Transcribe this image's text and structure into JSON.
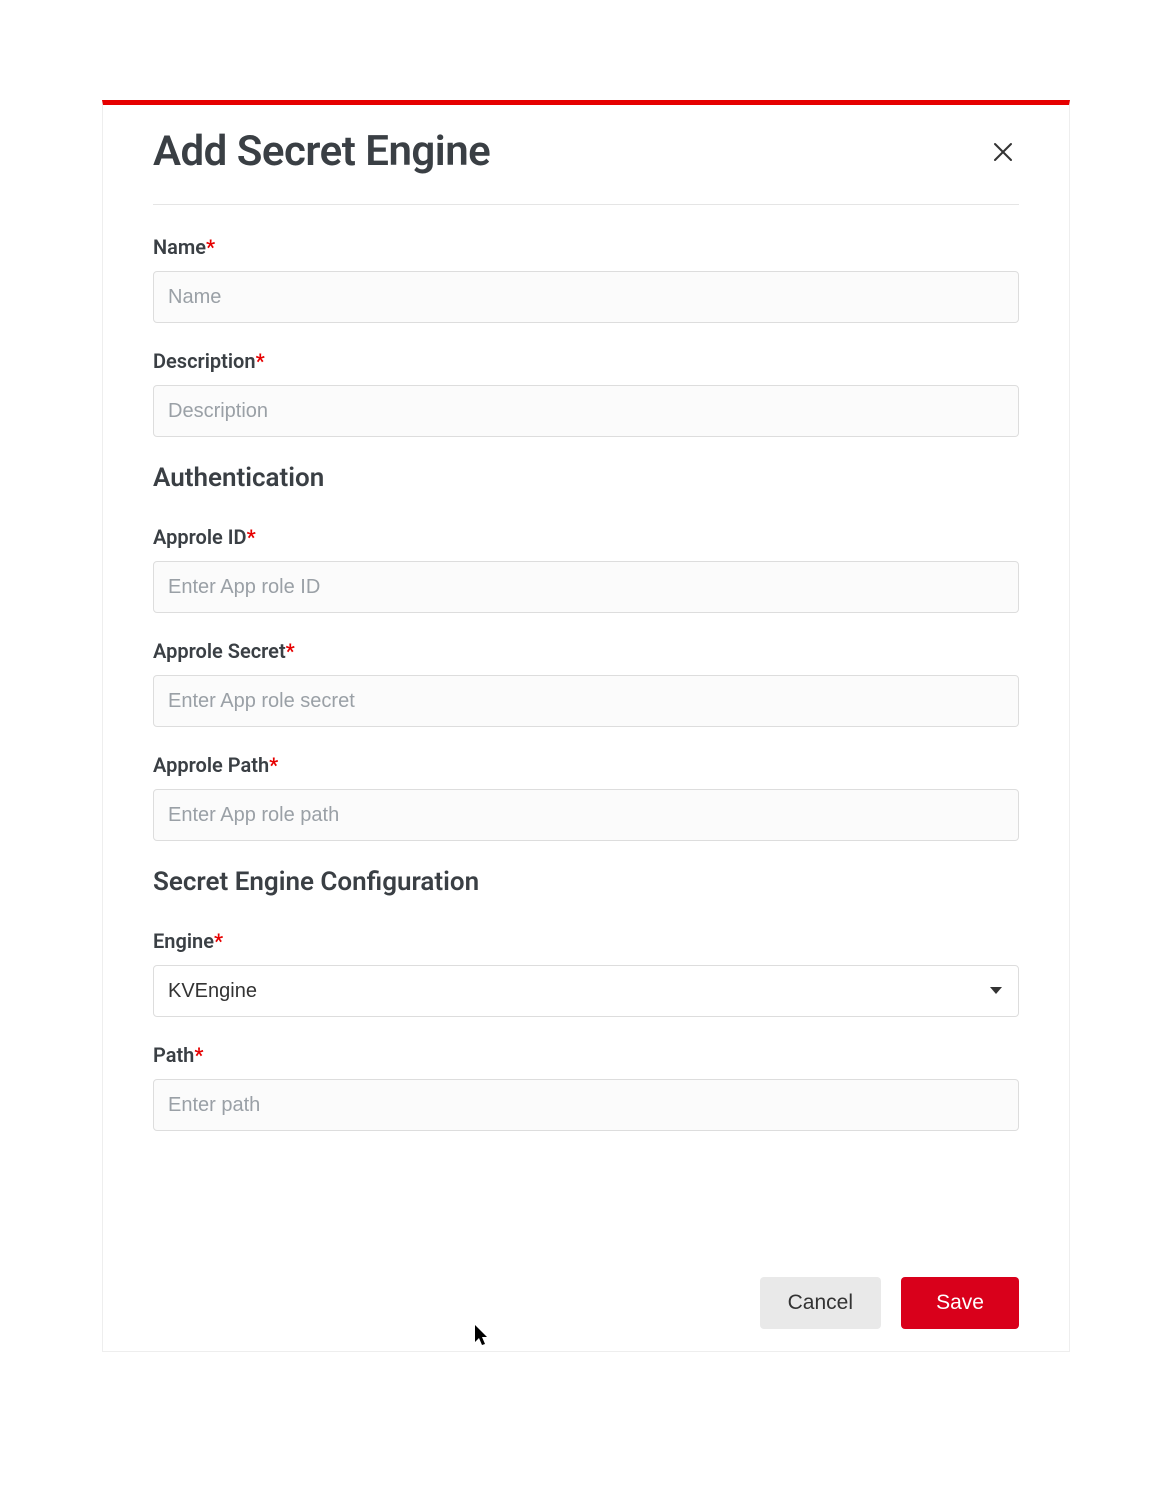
{
  "modal": {
    "title": "Add Secret Engine"
  },
  "fields": {
    "name": {
      "label": "Name",
      "placeholder": "Name"
    },
    "description": {
      "label": "Description",
      "placeholder": "Description"
    }
  },
  "sections": {
    "auth": {
      "heading": "Authentication",
      "approle_id": {
        "label": "Approle ID",
        "placeholder": "Enter App role ID"
      },
      "approle_secret": {
        "label": "Approle Secret",
        "placeholder": "Enter App role secret"
      },
      "approle_path": {
        "label": "Approle Path",
        "placeholder": "Enter App role path"
      }
    },
    "config": {
      "heading": "Secret Engine Configuration",
      "engine": {
        "label": "Engine",
        "selected": "KVEngine"
      },
      "path": {
        "label": "Path",
        "placeholder": "Enter path"
      }
    }
  },
  "required_mark": "*",
  "footer": {
    "cancel": "Cancel",
    "save": "Save"
  }
}
